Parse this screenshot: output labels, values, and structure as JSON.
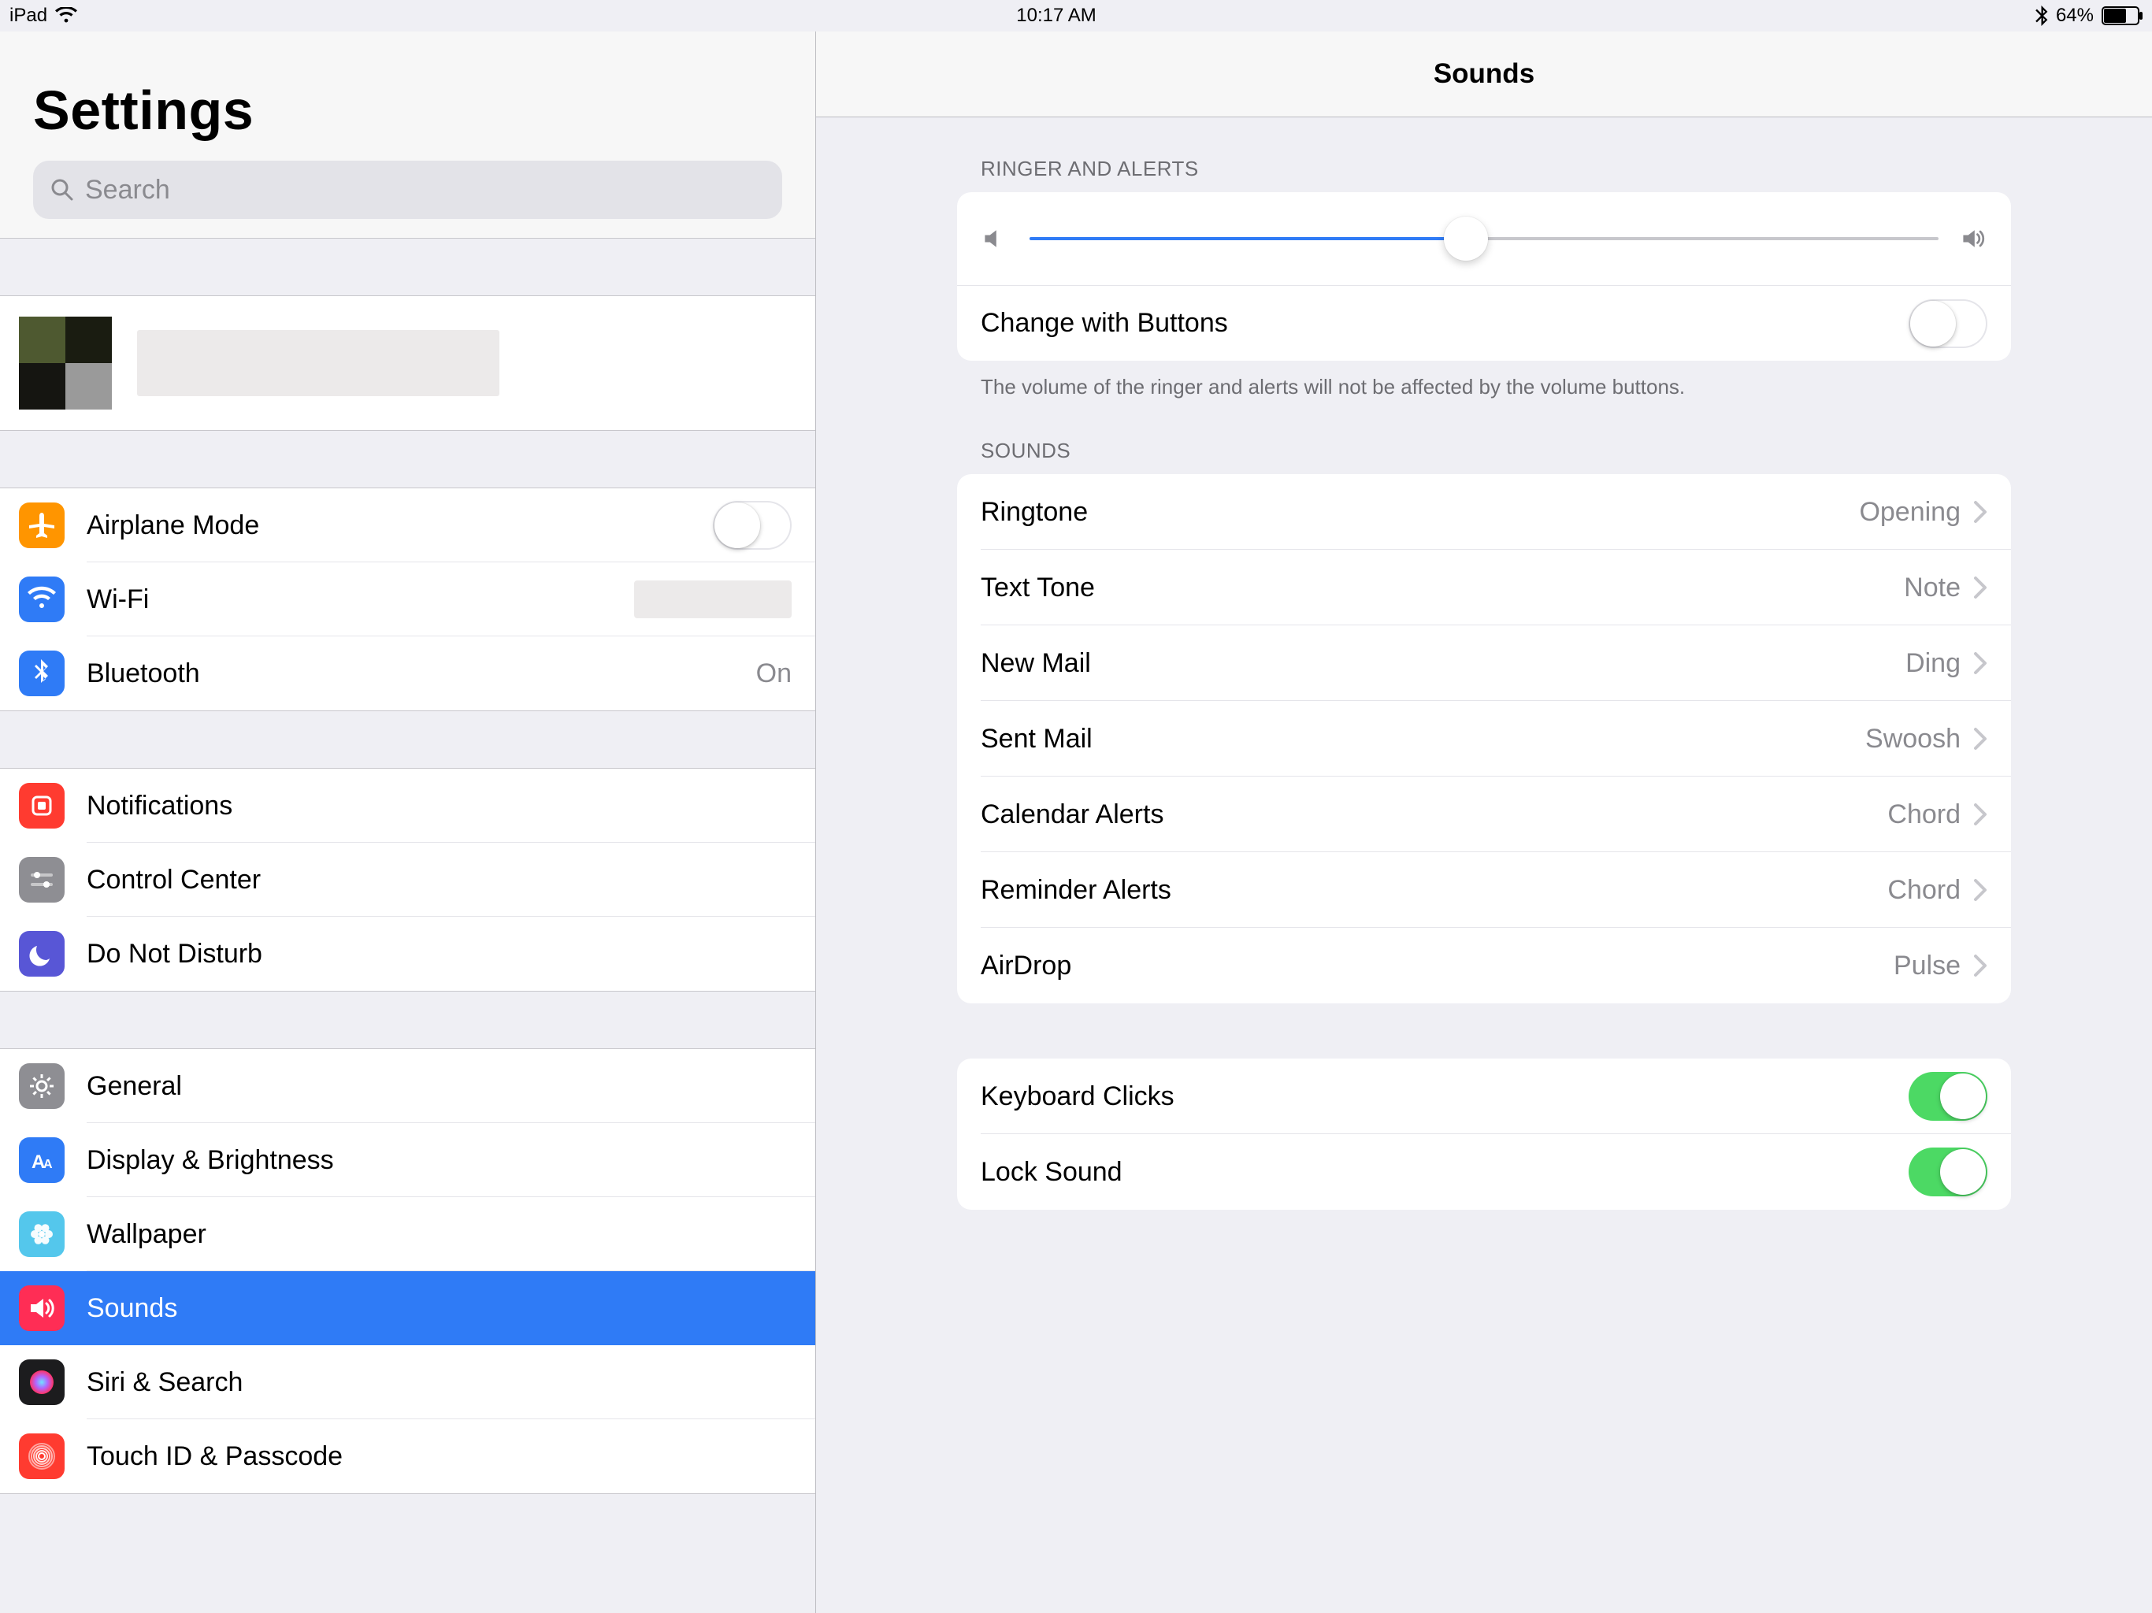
{
  "status": {
    "device": "iPad",
    "time": "10:17 AM",
    "battery_pct": "64%"
  },
  "sidebar": {
    "title": "Settings",
    "search_placeholder": "Search",
    "groups": [
      {
        "kind": "profile"
      },
      {
        "items": [
          {
            "id": "airplane",
            "label": "Airplane Mode",
            "color": "#ff9500",
            "toggle": false,
            "kind": "toggle"
          },
          {
            "id": "wifi",
            "label": "Wi-Fi",
            "color": "#2f7bf6",
            "value": "",
            "value_masked": true,
            "kind": "value"
          },
          {
            "id": "bluetooth",
            "label": "Bluetooth",
            "color": "#2f7bf6",
            "value": "On",
            "kind": "value"
          }
        ]
      },
      {
        "items": [
          {
            "id": "notifications",
            "label": "Notifications",
            "color": "#ff3b30"
          },
          {
            "id": "controlcenter",
            "label": "Control Center",
            "color": "#8e8e93"
          },
          {
            "id": "dnd",
            "label": "Do Not Disturb",
            "color": "#5856d6"
          }
        ]
      },
      {
        "items": [
          {
            "id": "general",
            "label": "General",
            "color": "#8e8e93"
          },
          {
            "id": "display",
            "label": "Display & Brightness",
            "color": "#2f7bf6"
          },
          {
            "id": "wallpaper",
            "label": "Wallpaper",
            "color": "#54c7ec"
          },
          {
            "id": "sounds",
            "label": "Sounds",
            "color": "#ff2d55",
            "selected": true
          },
          {
            "id": "siri",
            "label": "Siri & Search",
            "color": "#1c1c1e"
          },
          {
            "id": "touchid",
            "label": "Touch ID & Passcode",
            "color": "#ff3b30"
          }
        ]
      }
    ]
  },
  "detail": {
    "title": "Sounds",
    "sections": {
      "ringer": {
        "header": "RINGER AND ALERTS",
        "slider_pct": 48,
        "change_buttons": {
          "label": "Change with Buttons",
          "on": false
        },
        "footer": "The volume of the ringer and alerts will not be affected by the volume buttons."
      },
      "sounds": {
        "header": "SOUNDS",
        "items": [
          {
            "label": "Ringtone",
            "value": "Opening"
          },
          {
            "label": "Text Tone",
            "value": "Note"
          },
          {
            "label": "New Mail",
            "value": "Ding"
          },
          {
            "label": "Sent Mail",
            "value": "Swoosh"
          },
          {
            "label": "Calendar Alerts",
            "value": "Chord"
          },
          {
            "label": "Reminder Alerts",
            "value": "Chord"
          },
          {
            "label": "AirDrop",
            "value": "Pulse"
          }
        ]
      },
      "other": {
        "items": [
          {
            "label": "Keyboard Clicks",
            "on": true
          },
          {
            "label": "Lock Sound",
            "on": true
          }
        ]
      }
    }
  },
  "icons": {
    "airplane": "airplane",
    "wifi": "wifi",
    "bluetooth": "bluetooth",
    "notifications": "bell-square",
    "controlcenter": "sliders",
    "dnd": "moon",
    "general": "gear",
    "display": "text-size",
    "wallpaper": "flower",
    "sounds": "speaker",
    "siri": "siri",
    "touchid": "fingerprint"
  }
}
